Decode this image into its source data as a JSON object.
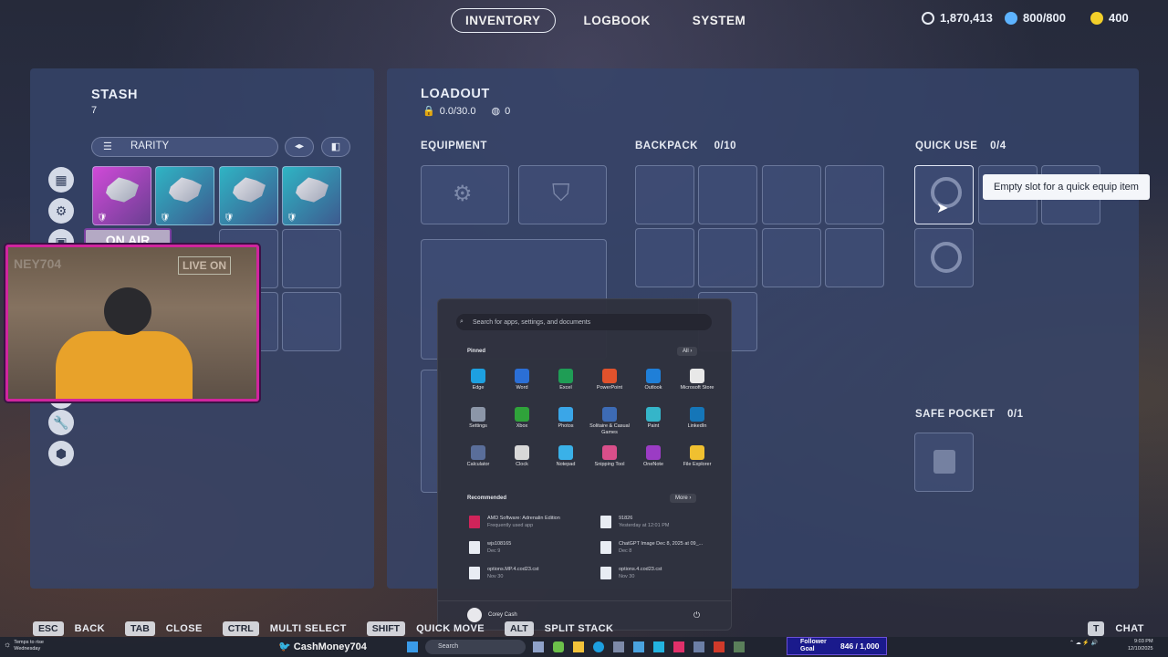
{
  "nav": {
    "tabs": [
      "INVENTORY",
      "LOGBOOK",
      "SYSTEM"
    ],
    "active": "INVENTORY"
  },
  "currency": {
    "coins": "1,870,413",
    "capacity": "800/800",
    "tokens": "400"
  },
  "stash": {
    "title": "STASH",
    "count": "7",
    "filter_label": "RARITY",
    "item_tags": [
      "🛡",
      "🛡",
      "🛡",
      "🛡",
      "🛡",
      "🛡"
    ]
  },
  "loadout": {
    "title": "LOADOUT",
    "weight": "0.0/30.0",
    "value": "0",
    "equipment_label": "EQUIPMENT",
    "backpack_label": "BACKPACK",
    "backpack_count": "0/10",
    "quick_use_label": "QUICK USE",
    "quick_use_count": "0/4",
    "safe_pocket_label": "SAFE POCKET",
    "safe_pocket_count": "0/1"
  },
  "tooltip": "Empty slot for a quick equip item",
  "overlay": {
    "on_air": "ON AIR",
    "sign": "LIVE ON",
    "ticker": "NEY704"
  },
  "start_menu": {
    "search_placeholder": "Search for apps, settings, and documents",
    "pinned_label": "Pinned",
    "all_label": "All",
    "apps": [
      {
        "name": "Edge",
        "color": "#1da0e0"
      },
      {
        "name": "Word",
        "color": "#2b6fd6"
      },
      {
        "name": "Excel",
        "color": "#1f9d55"
      },
      {
        "name": "PowerPoint",
        "color": "#e1522c"
      },
      {
        "name": "Outlook",
        "color": "#1f7fd8"
      },
      {
        "name": "Microsoft Store",
        "color": "#e8e8e8"
      },
      {
        "name": "Settings",
        "color": "#8c96a8"
      },
      {
        "name": "Xbox",
        "color": "#2fa33a"
      },
      {
        "name": "Photos",
        "color": "#3aa6e8"
      },
      {
        "name": "Solitaire & Casual Games",
        "color": "#3d6bb5"
      },
      {
        "name": "Paint",
        "color": "#35b5c9"
      },
      {
        "name": "LinkedIn",
        "color": "#1576b8"
      },
      {
        "name": "Calculator",
        "color": "#5a6e9a"
      },
      {
        "name": "Clock",
        "color": "#d8d8d8"
      },
      {
        "name": "Notepad",
        "color": "#3ab1e8"
      },
      {
        "name": "Snipping Tool",
        "color": "#d94f8a"
      },
      {
        "name": "OneNote",
        "color": "#9b3cc4"
      },
      {
        "name": "File Explorer",
        "color": "#f0c030"
      }
    ],
    "recommended_label": "Recommended",
    "more_label": "More",
    "recommended": [
      {
        "title": "AMD Software: Adrenalin Edition",
        "sub": "Frequently used app"
      },
      {
        "title": "91826",
        "sub": "Yesterday at 12:01 PM"
      },
      {
        "title": "wjs108165",
        "sub": "Dec 9"
      },
      {
        "title": "ChatGPT Image Dec 8, 2025 at 09_...",
        "sub": "Dec 8"
      },
      {
        "title": "options.MP.4.cod23.cst",
        "sub": "Nov 30"
      },
      {
        "title": "options.4.cod23.cst",
        "sub": "Nov 30"
      }
    ],
    "user": "Corey Cash"
  },
  "hints": [
    {
      "key": "ESC",
      "label": "BACK"
    },
    {
      "key": "TAB",
      "label": "CLOSE"
    },
    {
      "key": "CTRL",
      "label": "MULTI SELECT"
    },
    {
      "key": "SHIFT",
      "label": "QUICK MOVE"
    },
    {
      "key": "ALT",
      "label": "SPLIT STACK"
    }
  ],
  "chat": {
    "key": "T",
    "label": "CHAT"
  },
  "taskbar": {
    "weather": "Temps to rise",
    "weather_day": "Wednesday",
    "social": "CashMoney704",
    "search": "Search",
    "goal_label": "Follower Goal",
    "goal_value": "846 / 1,000",
    "time": "9:03 PM",
    "date": "12/10/2025"
  }
}
